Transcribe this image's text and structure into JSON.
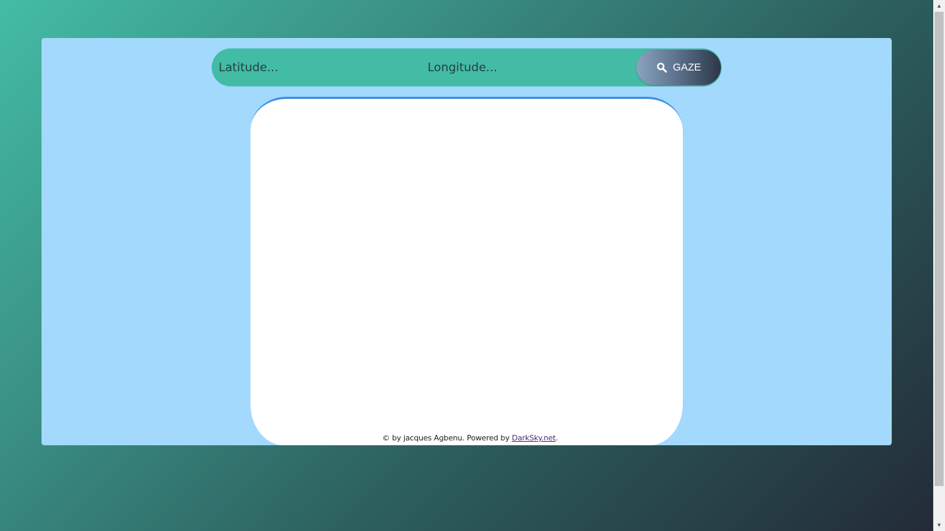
{
  "search": {
    "latitude_placeholder": "Latitude...",
    "longitude_placeholder": "Longitude...",
    "button_label": "GAZE",
    "button_icon": "search-icon"
  },
  "footer": {
    "prefix": "© by jacques Agbenu. Powered by ",
    "link_text": "DarkSky.net",
    "suffix": "."
  },
  "colors": {
    "panel": "#a3d9fd",
    "search_bar": "#43bca5",
    "card": "#ffffff",
    "card_accent": "#3b8ee3"
  }
}
